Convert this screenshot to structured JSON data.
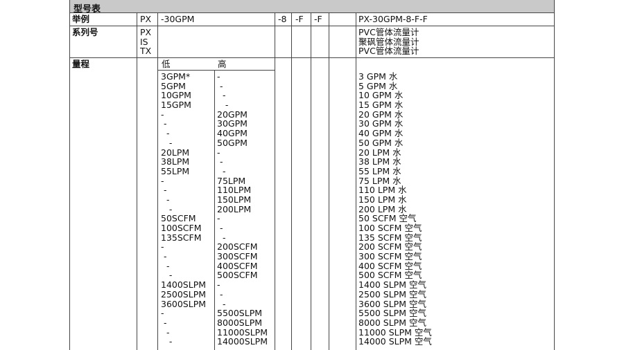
{
  "title": "型号表",
  "example": {
    "label": "举例",
    "prefix": "PX",
    "range": "-30GPM",
    "size": "-8",
    "opt1": "-F",
    "opt2": "-F",
    "result": "PX-30GPM-8-F-F"
  },
  "series": {
    "label": "系列号",
    "codes": [
      "PX",
      "IS",
      "TX"
    ],
    "descs": [
      "PVC管体流量计",
      "聚砜管体流量计",
      "PVC管体流量计"
    ]
  },
  "range": {
    "label": "量程",
    "low_header": "低",
    "high_header": "高",
    "rows": [
      {
        "low": "3GPM*",
        "high": "-",
        "desc": "3 GPM 水"
      },
      {
        "low": "5GPM",
        "high": " -",
        "desc": "5 GPM 水"
      },
      {
        "low": "10GPM",
        "high": "  -",
        "desc": "10 GPM 水"
      },
      {
        "low": "15GPM",
        "high": "   -",
        "desc": "15 GPM 水"
      },
      {
        "low": "-",
        "high": "20GPM",
        "desc": "20 GPM 水"
      },
      {
        "low": " -",
        "high": "30GPM",
        "desc": "30 GPM 水"
      },
      {
        "low": "  -",
        "high": "40GPM",
        "desc": "40 GPM 水"
      },
      {
        "low": "   -",
        "high": "50GPM",
        "desc": "50 GPM 水"
      },
      {
        "low": "20LPM",
        "high": "-",
        "desc": "20 LPM 水"
      },
      {
        "low": "38LPM",
        "high": " -",
        "desc": "38 LPM 水"
      },
      {
        "low": "55LPM",
        "high": "  -",
        "desc": "55 LPM 水"
      },
      {
        "low": "-",
        "high": "75LPM",
        "desc": "75 LPM 水"
      },
      {
        "low": " -",
        "high": "110LPM",
        "desc": "110 LPM 水"
      },
      {
        "low": "  -",
        "high": "150LPM",
        "desc": "150 LPM 水"
      },
      {
        "low": "   -",
        "high": "200LPM",
        "desc": "200 LPM 水"
      },
      {
        "low": "50SCFM",
        "high": "-",
        "desc": "50 SCFM 空气"
      },
      {
        "low": "100SCFM",
        "high": " -",
        "desc": "100 SCFM 空气"
      },
      {
        "low": "135SCFM",
        "high": "  -",
        "desc": "135 SCFM 空气"
      },
      {
        "low": "-",
        "high": "200SCFM",
        "desc": "200 SCFM 空气"
      },
      {
        "low": " -",
        "high": "300SCFM",
        "desc": "300 SCFM 空气"
      },
      {
        "low": "  -",
        "high": "400SCFM",
        "desc": "400 SCFM 空气"
      },
      {
        "low": "   -",
        "high": "500SCFM",
        "desc": "500 SCFM 空气"
      },
      {
        "low": "1400SLPM",
        "high": "-",
        "desc": "1400 SLPM 空气"
      },
      {
        "low": "2500SLPM",
        "high": " -",
        "desc": "2500 SLPM 空气"
      },
      {
        "low": "3600SLPM",
        "high": "  -",
        "desc": "3600 SLPM 空气"
      },
      {
        "low": "-",
        "high": "5500SLPM",
        "desc": "5500 SLPM 空气"
      },
      {
        "low": " -",
        "high": "8000SLPM",
        "desc": "8000 SLPM 空气"
      },
      {
        "low": "  -",
        "high": "11000SLPM",
        "desc": "11000 SLPM 空气"
      },
      {
        "low": "   -",
        "high": "14000SLPM",
        "desc": "14000 SLPM 空气"
      }
    ]
  }
}
